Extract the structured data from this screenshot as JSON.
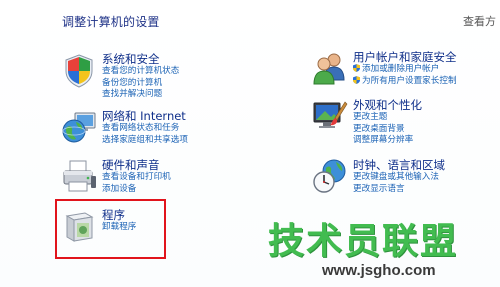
{
  "header": {
    "title": "调整计算机的设置",
    "view_by": "查看方"
  },
  "categories": [
    {
      "id": "system-security",
      "title": "系统和安全",
      "icon": "shield-flag-icon",
      "links": [
        "查看您的计算机状态",
        "备份您的计算机",
        "查找并解决问题"
      ]
    },
    {
      "id": "network-internet",
      "title": "网络和 Internet",
      "icon": "globe-network-icon",
      "links": [
        "查看网络状态和任务",
        "选择家庭组和共享选项"
      ]
    },
    {
      "id": "hardware-sound",
      "title": "硬件和声音",
      "icon": "printer-icon",
      "links": [
        "查看设备和打印机",
        "添加设备"
      ]
    },
    {
      "id": "programs",
      "title": "程序",
      "icon": "programs-box-icon",
      "links": [
        "卸载程序"
      ]
    },
    {
      "id": "user-accounts",
      "title": "用户帐户和家庭安全",
      "icon": "users-icon",
      "links": [
        "添加或删除用户帐户",
        "为所有用户设置家长控制"
      ]
    },
    {
      "id": "appearance",
      "title": "外观和个性化",
      "icon": "display-paint-icon",
      "links": [
        "更改主题",
        "更改桌面背景",
        "调整屏幕分辨率"
      ]
    },
    {
      "id": "clock-region",
      "title": "时钟、语言和区域",
      "icon": "clock-globe-icon",
      "links": [
        "更改键盘或其他输入法",
        "更改显示语言"
      ]
    }
  ],
  "watermark": {
    "text": "技术员联盟",
    "url": "www.jsgho.com"
  },
  "colors": {
    "title": "#1e3287",
    "category_title": "#0f2f8a",
    "link": "#1c63b5",
    "highlight": "#e1141c",
    "watermark": "#35b843"
  }
}
